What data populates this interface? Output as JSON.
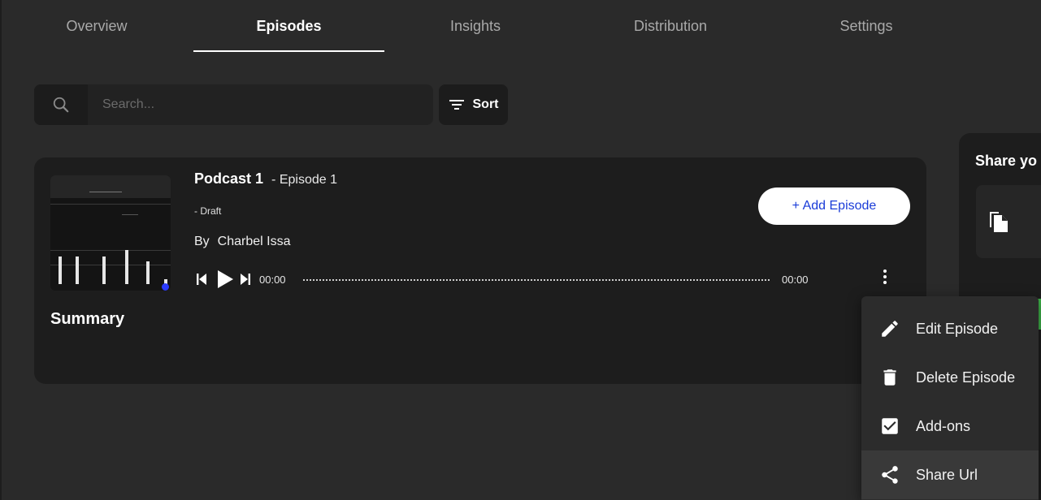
{
  "tabs": [
    {
      "label": "Overview",
      "active": false
    },
    {
      "label": "Episodes",
      "active": true
    },
    {
      "label": "Insights",
      "active": false
    },
    {
      "label": "Distribution",
      "active": false
    },
    {
      "label": "Settings",
      "active": false
    }
  ],
  "search": {
    "placeholder": "Search...",
    "value": ""
  },
  "sort": {
    "label": "Sort"
  },
  "episode": {
    "podcast_name": "Podcast 1",
    "episode_label": "- Episode 1",
    "status": "- Draft",
    "author_prefix": "By",
    "author": "Charbel Issa",
    "summary_label": "Summary",
    "time_current": "00:00",
    "time_total": "00:00",
    "add_button": "+ Add Episode"
  },
  "share_panel": {
    "title": "Share yo"
  },
  "menu": {
    "items": [
      {
        "label": "Edit Episode",
        "icon": "pencil-icon"
      },
      {
        "label": "Delete Episode",
        "icon": "trash-icon"
      },
      {
        "label": "Add-ons",
        "icon": "checkbox-icon"
      },
      {
        "label": "Share Url",
        "icon": "share-icon"
      }
    ]
  },
  "colors": {
    "background": "#2a2a2a",
    "card": "#1d1d1d",
    "accent_blue": "#1a3cd8",
    "menu": "#2c2c2c"
  }
}
